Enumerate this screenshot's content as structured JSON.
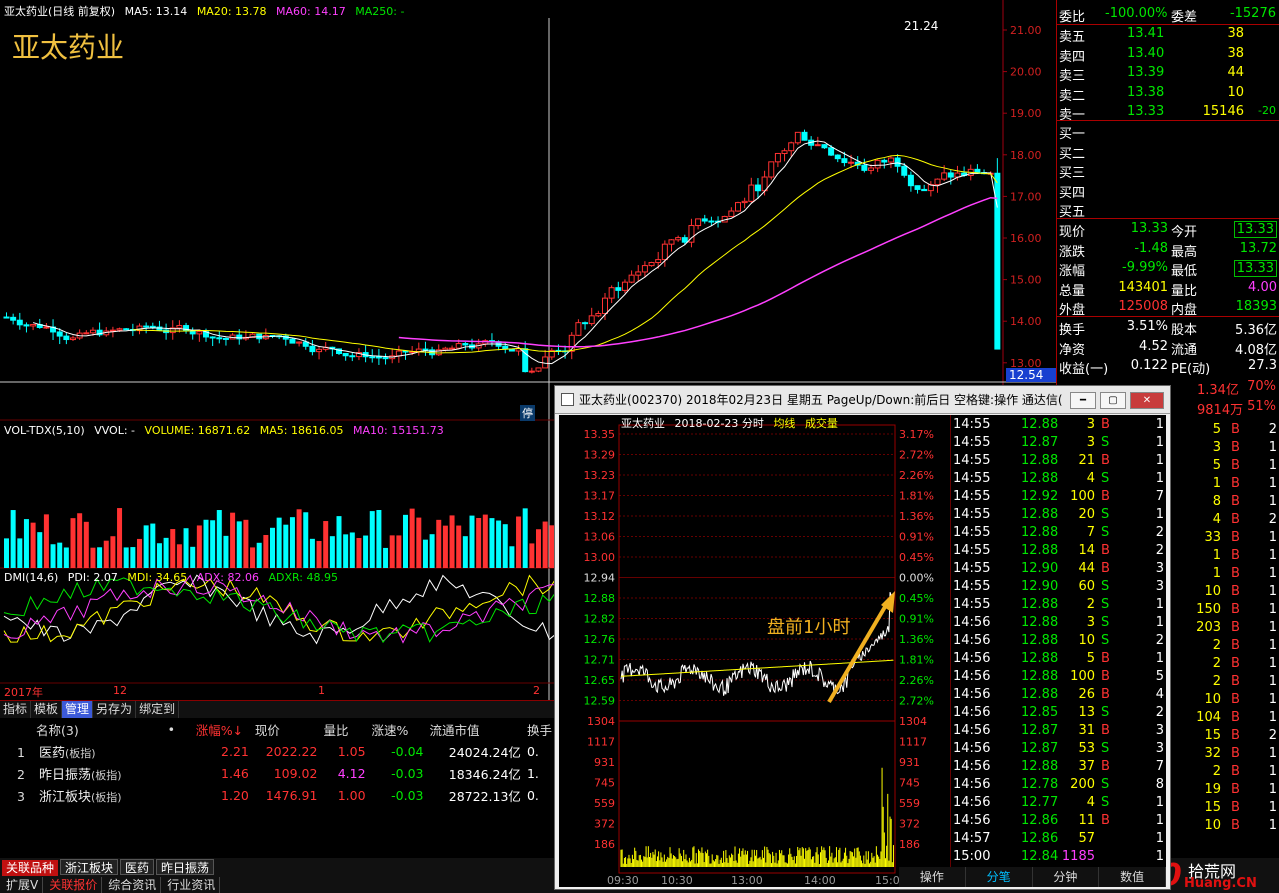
{
  "main": {
    "header": {
      "title": "亚太药业(日线 前复权)",
      "ma5": "MA5: 13.14",
      "ma20": "MA20: 13.78",
      "ma60": "MA60: 14.17",
      "ma250": "MA250: -"
    },
    "stock_name": "亚太药业",
    "price_axis": [
      "21.00",
      "20.00",
      "19.00",
      "18.00",
      "17.00",
      "16.00",
      "15.00",
      "14.00",
      "13.00"
    ],
    "current_price_tag": "12.54",
    "high_marker": "21.24",
    "limit_down_marker": "停",
    "volume_header": {
      "name": "VOL-TDX(5,10)",
      "vvol": "VVOL: -",
      "volume": "VOLUME: 16871.62",
      "ma5": "MA5: 18616.05",
      "ma10": "MA10: 15151.73"
    },
    "dmi_header": {
      "name": "DMI(14,6)",
      "pdi": "PDI: 2.07",
      "mdi": "MDI: 34.65",
      "adx": "ADX: 82.06",
      "adxr": "ADXR: 48.95"
    },
    "time_axis": [
      "2017年",
      "12",
      "1",
      "2"
    ]
  },
  "quote": {
    "weibi_label": "委比",
    "weibi": "-100.00%",
    "weicha_label": "委差",
    "weicha": "-15276",
    "asks": [
      {
        "label": "卖五",
        "price": "13.41",
        "vol": "38",
        "chg": ""
      },
      {
        "label": "卖四",
        "price": "13.40",
        "vol": "38",
        "chg": ""
      },
      {
        "label": "卖三",
        "price": "13.39",
        "vol": "44",
        "chg": ""
      },
      {
        "label": "卖二",
        "price": "13.38",
        "vol": "10",
        "chg": ""
      },
      {
        "label": "卖一",
        "price": "13.33",
        "vol": "15146",
        "chg": "-20"
      }
    ],
    "bids": [
      {
        "label": "买一"
      },
      {
        "label": "买二"
      },
      {
        "label": "买三"
      },
      {
        "label": "买四"
      },
      {
        "label": "买五"
      }
    ],
    "stats": [
      {
        "l1": "现价",
        "v1": "13.33",
        "c1": "grn",
        "l2": "今开",
        "v2": "13.33",
        "c2": "grn",
        "box2": true
      },
      {
        "l1": "涨跌",
        "v1": "-1.48",
        "c1": "grn",
        "l2": "最高",
        "v2": "13.72",
        "c2": "grn"
      },
      {
        "l1": "涨幅",
        "v1": "-9.99%",
        "c1": "grn",
        "l2": "最低",
        "v2": "13.33",
        "c2": "grn",
        "box2": true
      },
      {
        "l1": "总量",
        "v1": "143401",
        "c1": "yel",
        "l2": "量比",
        "v2": "4.00",
        "c2": "mag"
      },
      {
        "l1": "外盘",
        "v1": "125008",
        "c1": "red",
        "l2": "内盘",
        "v2": "18393",
        "c2": "grn"
      },
      {
        "l1": "换手",
        "v1": "3.51%",
        "c1": "wht",
        "l2": "股本",
        "v2": "5.36亿",
        "c2": "wht"
      },
      {
        "l1": "净资",
        "v1": "4.52",
        "c1": "wht",
        "l2": "流通",
        "v2": "4.08亿",
        "c2": "wht"
      },
      {
        "l1": "收益(一)",
        "v1": "0.122",
        "c1": "wht",
        "l2": "PE(动)",
        "v2": "27.3",
        "c2": "wht"
      }
    ],
    "extra1": {
      "v1": "1.34亿",
      "v2": "70%"
    },
    "extra2": {
      "v1": "9814万",
      "v2": "51%"
    }
  },
  "popup": {
    "title": "亚太药业(002370)  2018年02月23日  星期五  PageUp/Down:前后日  空格键:操作  通达信(",
    "chart_header": {
      "name": "亚太药业",
      "date": "2018-02-23 分时",
      "avg": "均线",
      "vol": "成交量"
    },
    "annotation": "盘前1小时",
    "footer_tabs": [
      "操作",
      "分笔",
      "分钟",
      "数值"
    ],
    "ticks": [
      {
        "t": "14:55",
        "p": "12.88",
        "v": "3",
        "bs": "B",
        "n": "1"
      },
      {
        "t": "14:55",
        "p": "12.87",
        "v": "3",
        "bs": "S",
        "n": "1"
      },
      {
        "t": "14:55",
        "p": "12.88",
        "v": "21",
        "bs": "B",
        "n": "1"
      },
      {
        "t": "14:55",
        "p": "12.88",
        "v": "4",
        "bs": "S",
        "n": "1"
      },
      {
        "t": "14:55",
        "p": "12.92",
        "v": "100",
        "bs": "B",
        "n": "7"
      },
      {
        "t": "14:55",
        "p": "12.88",
        "v": "20",
        "bs": "S",
        "n": "1"
      },
      {
        "t": "14:55",
        "p": "12.88",
        "v": "7",
        "bs": "S",
        "n": "2"
      },
      {
        "t": "14:55",
        "p": "12.88",
        "v": "14",
        "bs": "B",
        "n": "2"
      },
      {
        "t": "14:55",
        "p": "12.90",
        "v": "44",
        "bs": "B",
        "n": "3"
      },
      {
        "t": "14:55",
        "p": "12.90",
        "v": "60",
        "bs": "S",
        "n": "3"
      },
      {
        "t": "14:55",
        "p": "12.88",
        "v": "2",
        "bs": "S",
        "n": "1"
      },
      {
        "t": "14:56",
        "p": "12.88",
        "v": "3",
        "bs": "S",
        "n": "1"
      },
      {
        "t": "14:56",
        "p": "12.88",
        "v": "10",
        "bs": "S",
        "n": "2"
      },
      {
        "t": "14:56",
        "p": "12.88",
        "v": "5",
        "bs": "B",
        "n": "1"
      },
      {
        "t": "14:56",
        "p": "12.88",
        "v": "100",
        "bs": "B",
        "n": "5"
      },
      {
        "t": "14:56",
        "p": "12.88",
        "v": "26",
        "bs": "B",
        "n": "4"
      },
      {
        "t": "14:56",
        "p": "12.85",
        "v": "13",
        "bs": "S",
        "n": "2"
      },
      {
        "t": "14:56",
        "p": "12.87",
        "v": "31",
        "bs": "B",
        "n": "3"
      },
      {
        "t": "14:56",
        "p": "12.87",
        "v": "53",
        "bs": "S",
        "n": "3"
      },
      {
        "t": "14:56",
        "p": "12.88",
        "v": "37",
        "bs": "B",
        "n": "7"
      },
      {
        "t": "14:56",
        "p": "12.78",
        "v": "200",
        "bs": "S",
        "n": "8"
      },
      {
        "t": "14:56",
        "p": "12.77",
        "v": "4",
        "bs": "S",
        "n": "1"
      },
      {
        "t": "14:56",
        "p": "12.86",
        "v": "11",
        "bs": "B",
        "n": "1"
      },
      {
        "t": "14:57",
        "p": "12.86",
        "v": "57",
        "bs": "",
        "n": "1"
      },
      {
        "t": "15:00",
        "p": "12.84",
        "v": "1185",
        "bs": "",
        "n": "1"
      }
    ]
  },
  "right_trades": [
    {
      "v": "5",
      "bs": "B",
      "n": "2"
    },
    {
      "v": "3",
      "bs": "B",
      "n": "1"
    },
    {
      "v": "5",
      "bs": "B",
      "n": "1"
    },
    {
      "v": "1",
      "bs": "B",
      "n": "1"
    },
    {
      "v": "8",
      "bs": "B",
      "n": "1"
    },
    {
      "v": "4",
      "bs": "B",
      "n": "2"
    },
    {
      "v": "33",
      "bs": "B",
      "n": "1"
    },
    {
      "v": "1",
      "bs": "B",
      "n": "1"
    },
    {
      "v": "1",
      "bs": "B",
      "n": "1"
    },
    {
      "v": "10",
      "bs": "B",
      "n": "1"
    },
    {
      "v": "150",
      "bs": "B",
      "n": "1"
    },
    {
      "v": "203",
      "bs": "B",
      "n": "1"
    },
    {
      "v": "2",
      "bs": "B",
      "n": "1"
    },
    {
      "v": "2",
      "bs": "B",
      "n": "1"
    },
    {
      "v": "2",
      "bs": "B",
      "n": "1"
    },
    {
      "v": "10",
      "bs": "B",
      "n": "1"
    },
    {
      "v": "104",
      "bs": "B",
      "n": "1"
    },
    {
      "v": "15",
      "bs": "B",
      "n": "2"
    },
    {
      "v": "32",
      "bs": "B",
      "n": "1"
    },
    {
      "v": "2",
      "bs": "B",
      "n": "1"
    },
    {
      "v": "19",
      "bs": "B",
      "n": "1"
    },
    {
      "v": "15",
      "bs": "B",
      "n": "1"
    },
    {
      "v": "10",
      "bs": "B",
      "n": "1"
    }
  ],
  "bottom": {
    "tabs": [
      "指标",
      "模板",
      "管理",
      "另存为",
      "绑定到"
    ],
    "active_tab": "管理",
    "columns": [
      "名称(3)",
      "•",
      "涨幅%↓",
      "现价",
      "量比",
      "涨速%",
      "流通市值",
      "换手"
    ],
    "rows": [
      {
        "idx": "1",
        "name": "医药",
        "tag": "(板指)",
        "chg": "2.21",
        "price": "2022.22",
        "lb": "1.05",
        "lbc": "red",
        "speed": "-0.04",
        "cap": "24024.24亿",
        "turn": "0."
      },
      {
        "idx": "2",
        "name": "昨日振荡",
        "tag": "(板指)",
        "chg": "1.46",
        "price": "109.02",
        "lb": "4.12",
        "lbc": "mag",
        "speed": "-0.03",
        "cap": "18346.24亿",
        "turn": "1."
      },
      {
        "idx": "3",
        "name": "浙江板块",
        "tag": "(板指)",
        "chg": "1.20",
        "price": "1476.91",
        "lb": "1.00",
        "lbc": "red",
        "speed": "-0.03",
        "cap": "28722.13亿",
        "turn": "0."
      }
    ]
  },
  "statusbar": {
    "row1": [
      "关联品种",
      "浙江板块",
      "医药",
      "昨日振荡"
    ],
    "row2": [
      "扩展V",
      "关联报价",
      "综合资讯",
      "行业资讯"
    ],
    "watermark": "拾荒网",
    "watermark2": "Huang.CN"
  }
}
